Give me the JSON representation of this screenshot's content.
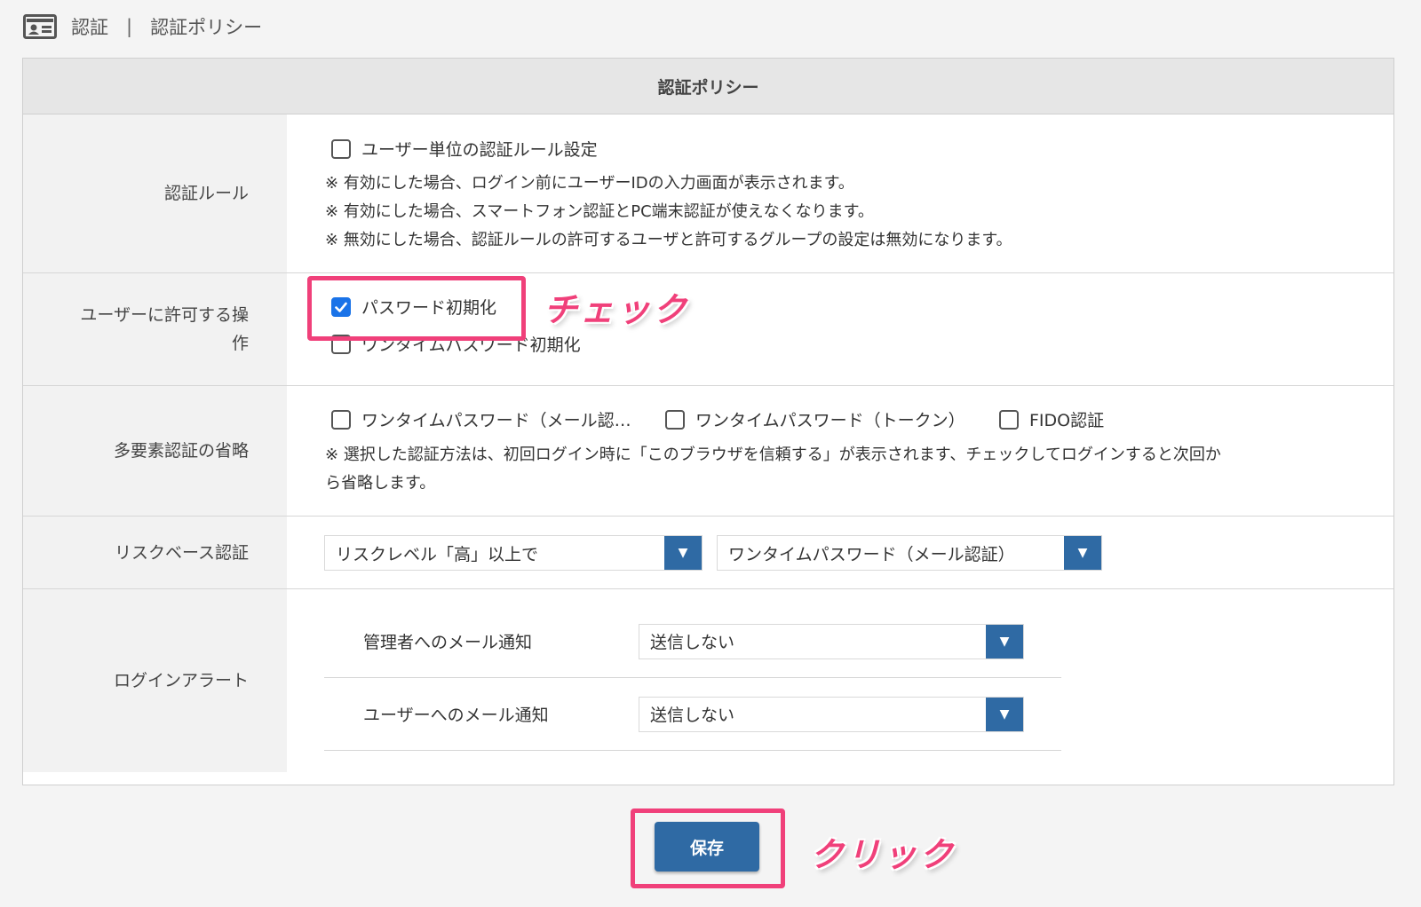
{
  "breadcrumb": {
    "icon": "id-card-icon",
    "section": "認証",
    "separator": "|",
    "page": "認証ポリシー"
  },
  "panel": {
    "title": "認証ポリシー"
  },
  "auth_rule": {
    "label": "認証ルール",
    "checkbox_label": "ユーザー単位の認証ルール設定",
    "checked": false,
    "notes": [
      "※ 有効にした場合、ログイン前にユーザーIDの入力画面が表示されます。",
      "※ 有効にした場合、スマートフォン認証とPC端末認証が使えなくなります。",
      "※ 無効にした場合、認証ルールの許可するユーザと許可するグループの設定は無効になります。"
    ]
  },
  "user_ops": {
    "label_line1": "ユーザーに許可する操",
    "label_line2": "作",
    "options": [
      {
        "label": "パスワード初期化",
        "checked": true
      },
      {
        "label": "ワンタイムパスワード初期化",
        "checked": false
      }
    ]
  },
  "mfa_skip": {
    "label": "多要素認証の省略",
    "options": [
      {
        "label": "ワンタイムパスワード（メール認…",
        "checked": false
      },
      {
        "label": "ワンタイムパスワード（トークン）",
        "checked": false
      },
      {
        "label": "FIDO認証",
        "checked": false
      }
    ],
    "note_line1": "※ 選択した認証方法は、初回ログイン時に「このブラウザを信頼する」が表示されます、チェックしてログインすると次回か",
    "note_line2": "ら省略します。"
  },
  "risk_based": {
    "label": "リスクベース認証",
    "level_select": "リスクレベル「高」以上で",
    "method_select": "ワンタイムパスワード（メール認証）"
  },
  "login_alert": {
    "label": "ログインアラート",
    "admin_label": "管理者へのメール通知",
    "admin_value": "送信しない",
    "user_label": "ユーザーへのメール通知",
    "user_value": "送信しない"
  },
  "actions": {
    "save_label": "保存"
  },
  "annotations": {
    "check_text": "チェック",
    "click_text": "クリック",
    "highlight_color": "#f0407a"
  },
  "colors": {
    "accent": "#2f6aa4",
    "checkbox_checked": "#1a73e8"
  }
}
